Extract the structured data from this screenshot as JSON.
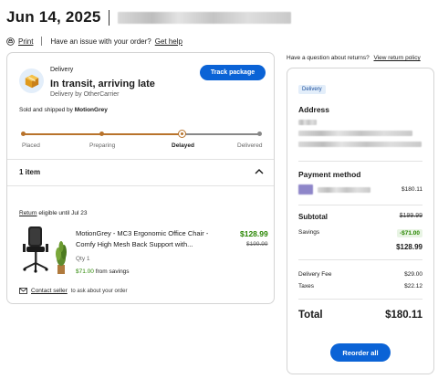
{
  "header": {
    "date": "Jun 14, 2025"
  },
  "links": {
    "print": "Print",
    "issue_text": "Have an issue with your order?",
    "help": "Get help"
  },
  "delivery": {
    "label": "Delivery",
    "status": "In transit, arriving late",
    "carrier": "Delivery by OtherCarrier",
    "track_button": "Track package",
    "seller_prefix": "Sold and shipped by",
    "seller": "MotionGrey",
    "progress": {
      "steps": [
        "Placed",
        "Preparing",
        "Delayed",
        "Delivered"
      ],
      "current_step": 2
    }
  },
  "items": {
    "count_label": "1 item",
    "return_link": "Return",
    "return_text": "eligible until Jul 23",
    "product": {
      "name": "MotionGrey - MC3 Ergonomic Office Chair - Comfy High Mesh Back Support with...",
      "price": "$128.99",
      "original_price": "$199.99",
      "qty": "Qty 1",
      "savings_amount": "$71.00",
      "savings_text": "from savings"
    },
    "contact_link": "Contact seller",
    "contact_text": "to ask about your order"
  },
  "returns": {
    "question": "Have a question about returns?",
    "link": "View return policy"
  },
  "summary": {
    "tag": "Delivery",
    "address_heading": "Address",
    "payment_heading": "Payment method",
    "payment_amount": "$180.11",
    "subtotal_label": "Subtotal",
    "subtotal_value": "$199.99",
    "savings_label": "Savings",
    "savings_value": "-$71.00",
    "net_value": "$128.99",
    "delivery_fee_label": "Delivery Fee",
    "delivery_fee_value": "$29.00",
    "taxes_label": "Taxes",
    "taxes_value": "$22.12",
    "total_label": "Total",
    "total_value": "$180.11",
    "reorder_button": "Reorder all"
  },
  "colors": {
    "accent": "#0b63d6",
    "progress": "#b8732b",
    "savings": "#2a8703"
  },
  "icons": [
    "printer-icon",
    "box-icon",
    "chevron-up-icon",
    "mail-icon"
  ]
}
